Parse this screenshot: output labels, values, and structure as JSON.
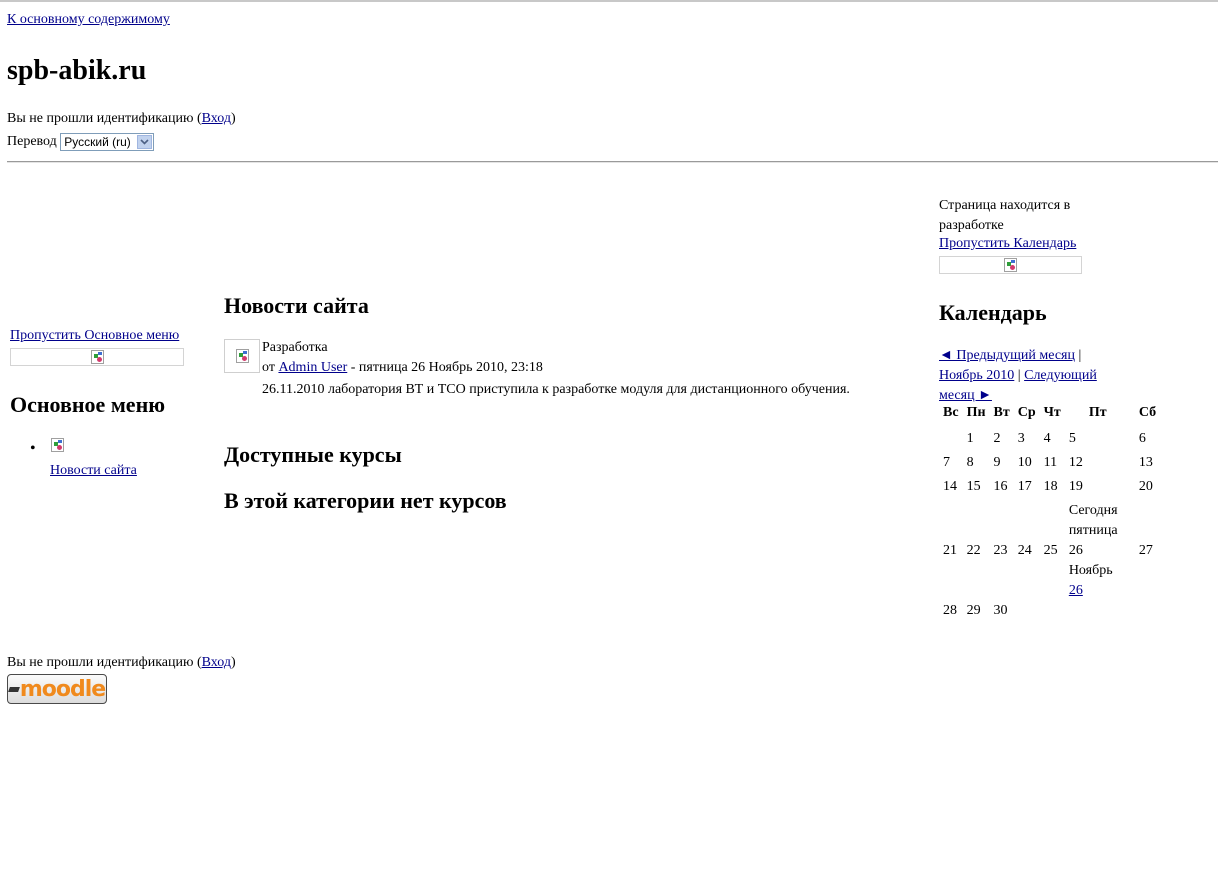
{
  "header": {
    "skip_link": "К основному содержимому",
    "site_title": "spb-abik.ru",
    "login_info_prefix": "Вы не прошли идентификацию (",
    "login_link": "Вход",
    "login_info_suffix": ")",
    "translate_label": "Перевод",
    "language_selected": "Русский (ru)"
  },
  "left": {
    "skip_link": "Пропустить Основное меню",
    "menu_title": "Основное меню",
    "menu_items": [
      {
        "label": "Новости сайта",
        "icon": "broken-image-icon"
      }
    ]
  },
  "center": {
    "news_title": "Новости сайта",
    "post": {
      "subject": "Разработка",
      "by_prefix": "от ",
      "author": "Admin User",
      "date": " - пятница 26 Ноябрь 2010, 23:18",
      "text": "26.11.2010 лаборатория ВТ и ТСО приступила к разработке модуля для дистанционного обучения."
    },
    "courses_title": "Доступные курсы",
    "no_courses": "В этой категории нет курсов"
  },
  "right": {
    "dev_notice": "Страница находится в разработке",
    "skip_calendar": "Пропустить Календарь",
    "calendar_title": "Календарь",
    "prev_month": "◄ Предыдущий месяц",
    "separator": " | ",
    "current_month": "Ноябрь 2010",
    "next_month": "Следующий месяц ►",
    "weekdays": [
      "Вс",
      "Пн",
      "Вт",
      "Ср",
      "Чт",
      "Пт",
      "Сб"
    ],
    "weeks": [
      [
        "",
        "1",
        "2",
        "3",
        "4",
        "5",
        "6"
      ],
      [
        "7",
        "8",
        "9",
        "10",
        "11",
        "12",
        "13"
      ],
      [
        "14",
        "15",
        "16",
        "17",
        "18",
        "19",
        "20"
      ],
      [
        "21",
        "22",
        "23",
        "24",
        "25",
        "26",
        "27"
      ],
      [
        "28",
        "29",
        "30",
        "",
        "",
        "",
        ""
      ]
    ],
    "today_tooltip": {
      "line1": "Сегодня",
      "line2": "пятница",
      "line3": "Ноябрь",
      "link": "26"
    }
  },
  "footer": {
    "login_info_prefix": "Вы не прошли идентификацию (",
    "login_link": "Вход",
    "login_info_suffix": ")",
    "logo_text": "moodle"
  }
}
